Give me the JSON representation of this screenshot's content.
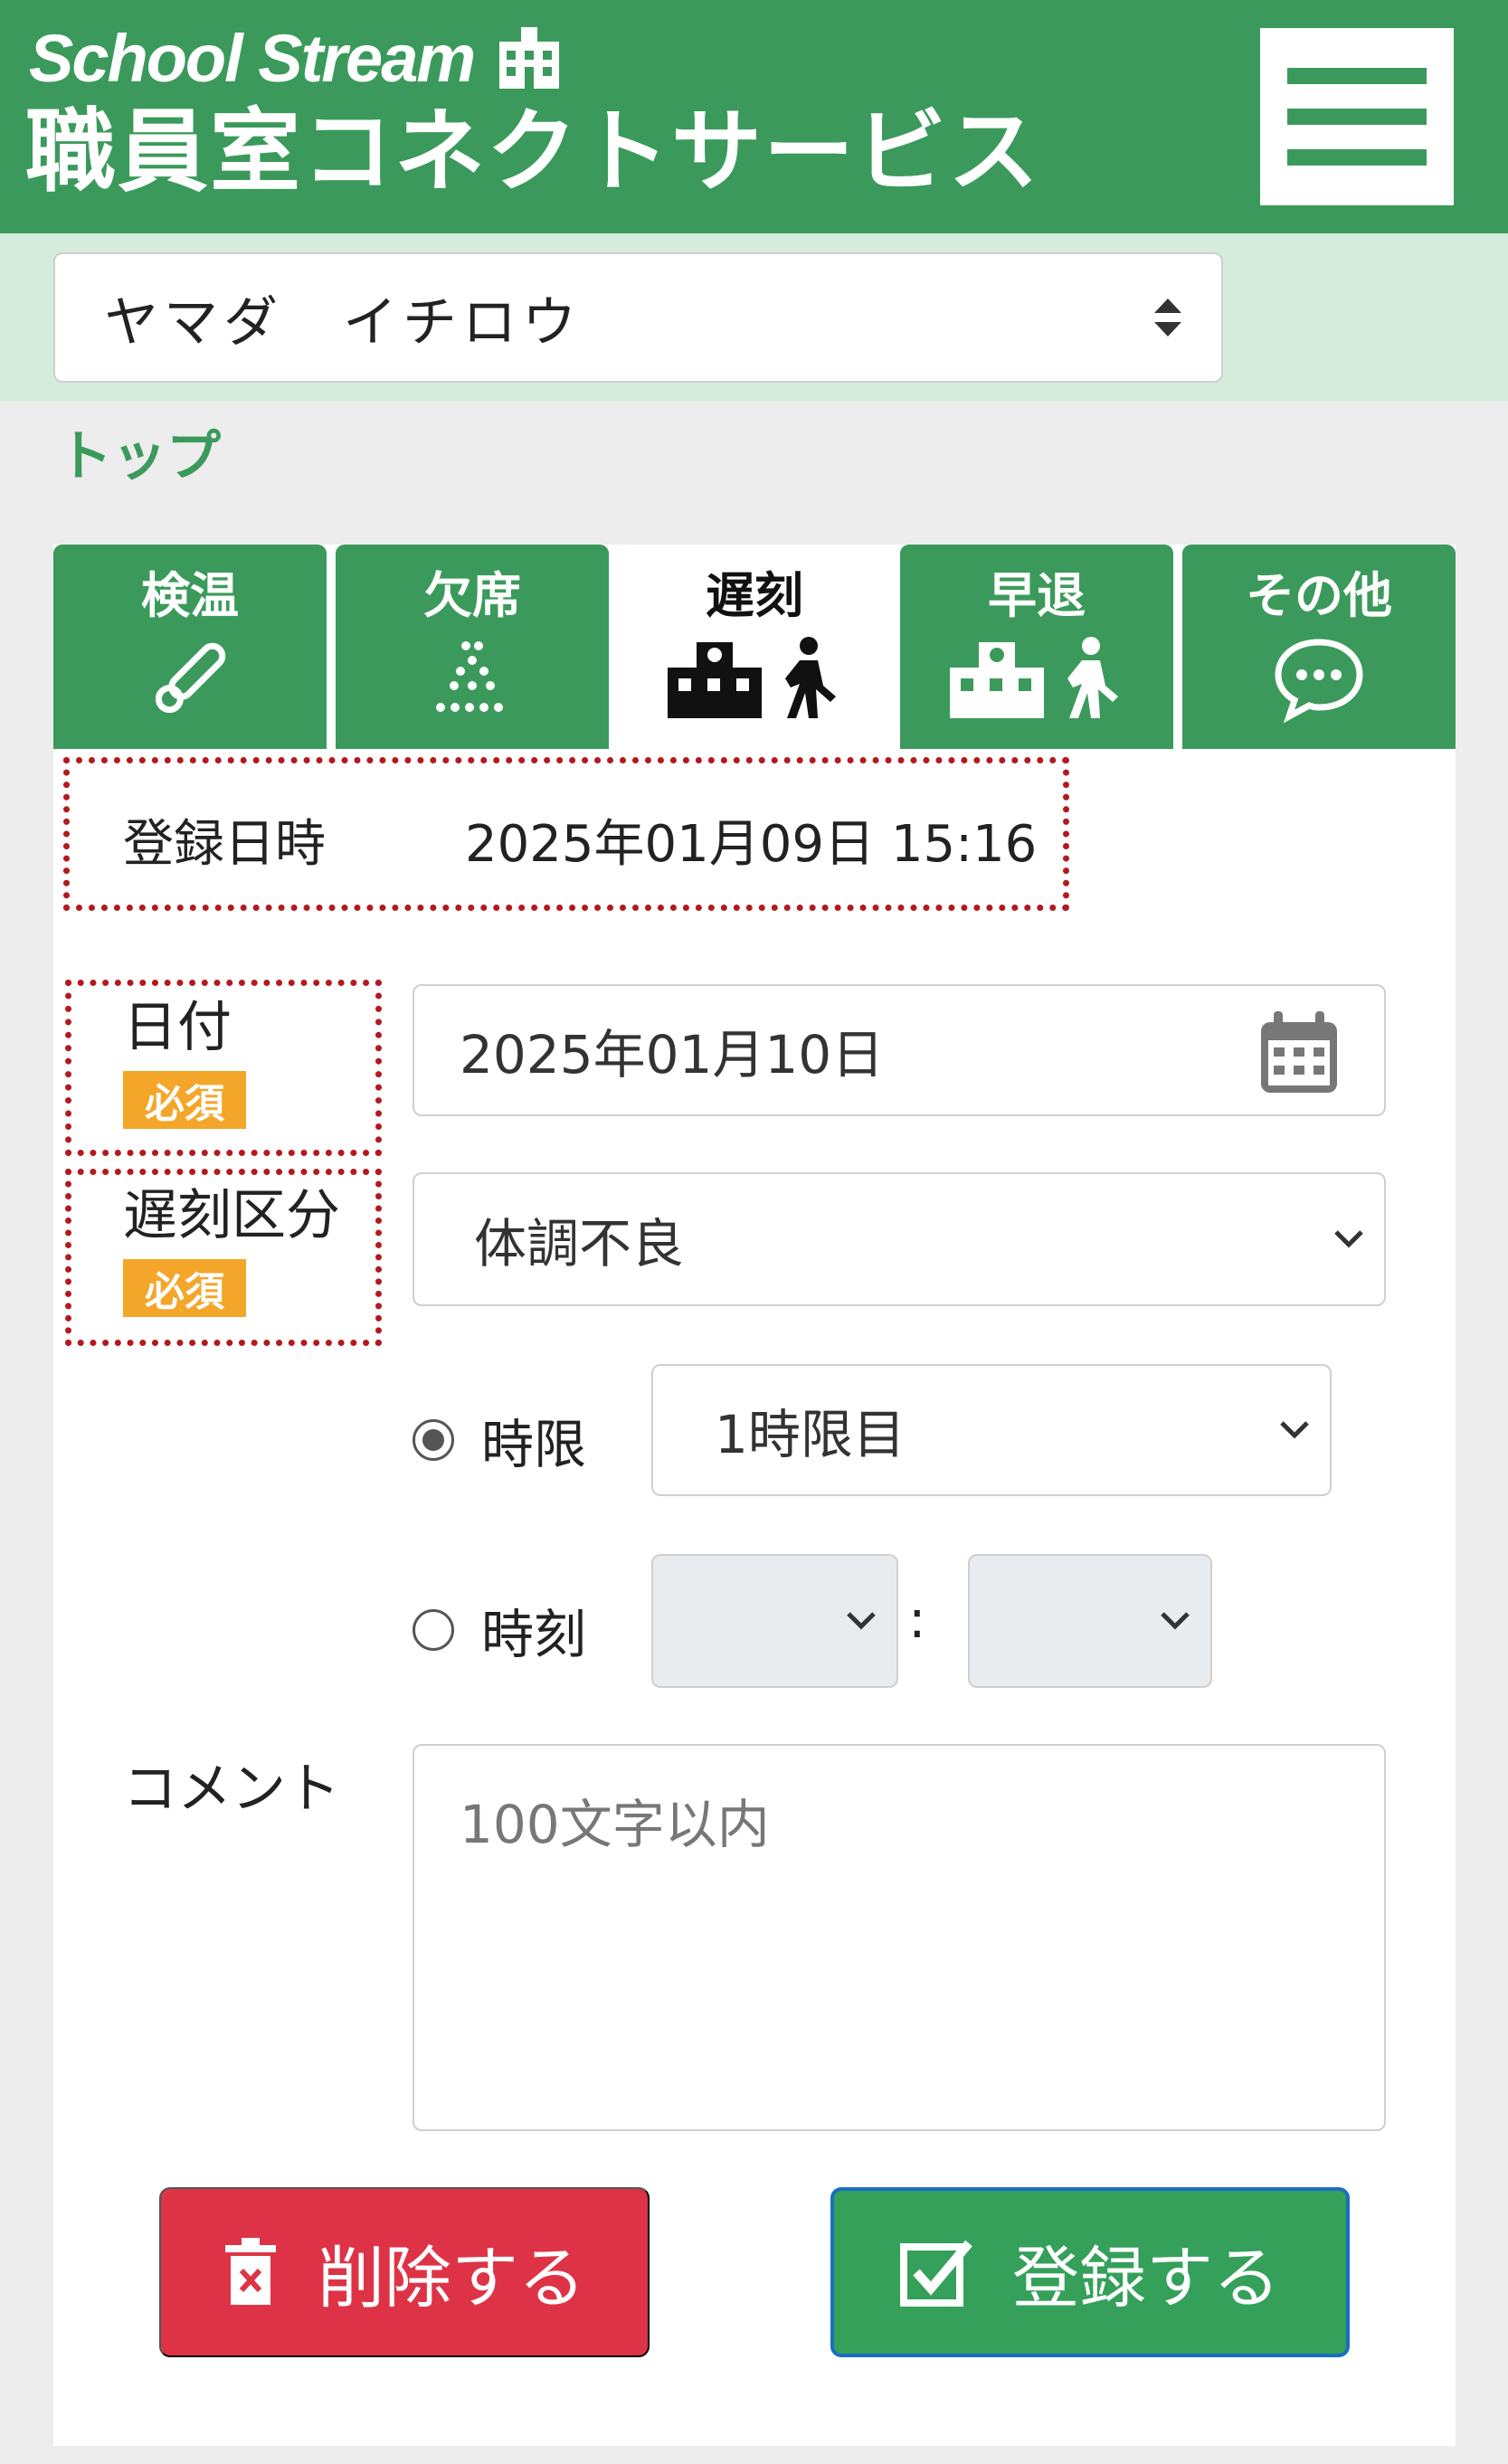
{
  "header": {
    "brand_top": "School Stream",
    "brand_bottom": "職員室コネクトサービス",
    "menu_icon": "hamburger-icon"
  },
  "user_select": {
    "value": "ヤマダ　イチロウ"
  },
  "breadcrumb": "トップ",
  "tabs": [
    {
      "label": "検温",
      "icon": "thermometer-icon",
      "active": false
    },
    {
      "label": "欠席",
      "icon": "absence-dots-icon",
      "active": false
    },
    {
      "label": "遅刻",
      "icon": "school-walker-icon",
      "active": true
    },
    {
      "label": "早退",
      "icon": "school-walker-icon",
      "active": false
    },
    {
      "label": "その他",
      "icon": "chat-bubble-icon",
      "active": false
    }
  ],
  "registration": {
    "label": "登録日時",
    "value": "2025年01月09日 15:16"
  },
  "form": {
    "date": {
      "label": "日付",
      "required": "必須",
      "value": "2025年01月10日",
      "icon": "calendar-icon"
    },
    "late_type": {
      "label": "遅刻区分",
      "required": "必須",
      "value": "体調不良"
    },
    "period": {
      "label": "時限",
      "value": "1時限目",
      "selected": true
    },
    "time": {
      "label": "時刻",
      "hour": "",
      "minute": "",
      "separator": ":",
      "selected": false
    },
    "comment": {
      "label": "コメント",
      "placeholder": "100文字以内"
    }
  },
  "actions": {
    "delete_label": "削除する",
    "register_label": "登録する"
  },
  "colors": {
    "brand_green": "#3b9a5b",
    "required_orange": "#f4a62a",
    "delete_red": "#de3346",
    "highlight_red": "#b3191e"
  }
}
